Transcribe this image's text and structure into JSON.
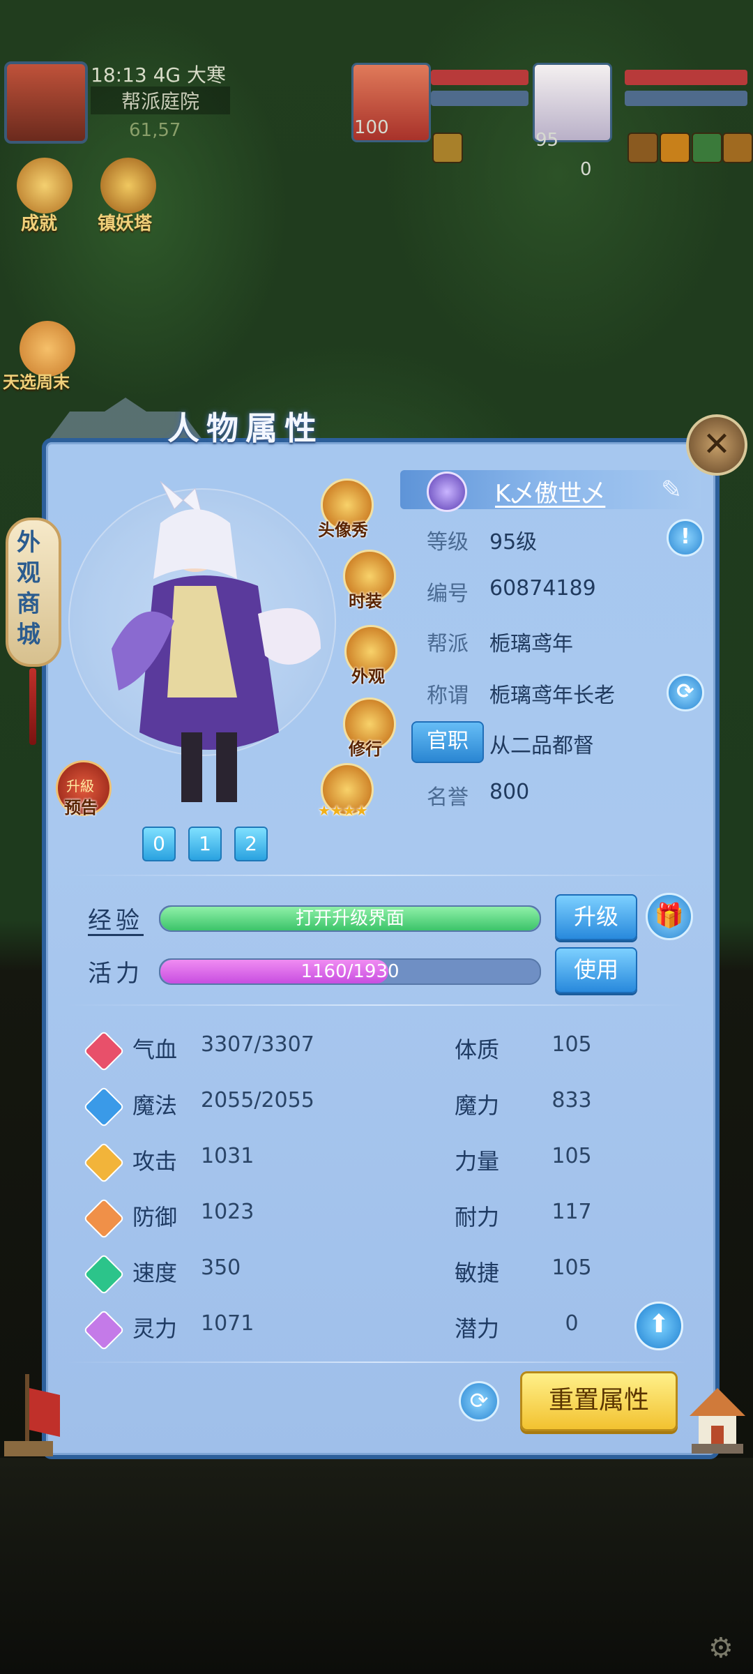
{
  "hud": {
    "time_status": "18:13 4G 大寒",
    "location": "帮派庭院",
    "coordinates": "61,57",
    "achievement_label": "成就",
    "tower_label": "镇妖塔",
    "weekend_label": "天选周末",
    "portrait1_level": "100",
    "portrait2_level": "95",
    "counter": "0"
  },
  "panel": {
    "title": "人物属性",
    "close_icon": "close-icon",
    "shop_tab": "外观商城",
    "side_buttons": [
      {
        "label": "头像秀",
        "icon": "avatar-show-icon"
      },
      {
        "label": "时装",
        "icon": "fashion-icon"
      },
      {
        "label": "外观",
        "icon": "appearance-icon"
      },
      {
        "label": "修行",
        "icon": "cultivation-icon"
      },
      {
        "label": "",
        "icon": "star-rank-icon"
      }
    ],
    "notice_label": "预告",
    "notice_inner": "升級",
    "pages": [
      "0",
      "1",
      "2"
    ],
    "stars": "★★★★"
  },
  "profile": {
    "name": "K乄傲世乄",
    "rows": [
      {
        "label": "等级",
        "value": "95级"
      },
      {
        "label": "编号",
        "value": "60874189"
      },
      {
        "label": "帮派",
        "value": "栀璃鸢年"
      },
      {
        "label": "称谓",
        "value": "栀璃鸢年长老"
      },
      {
        "label": "官职",
        "value": "从二品都督"
      },
      {
        "label": "名誉",
        "value": "800"
      }
    ]
  },
  "progress": {
    "exp_label": "经验",
    "exp_text": "打开升级界面",
    "exp_fraction": 1.0,
    "upgrade_button": "升级",
    "vitality_label": "活力",
    "vitality_text": "1160/1930",
    "vitality_fraction": 0.601,
    "use_button": "使用"
  },
  "stats": [
    {
      "label": "气血",
      "value": "3307/3307",
      "color": "#e8506a",
      "attr_label": "体质",
      "attr_value": "105"
    },
    {
      "label": "魔法",
      "value": "2055/2055",
      "color": "#3a9ae8",
      "attr_label": "魔力",
      "attr_value": "833"
    },
    {
      "label": "攻击",
      "value": "1031",
      "color": "#f2b43a",
      "attr_label": "力量",
      "attr_value": "105"
    },
    {
      "label": "防御",
      "value": "1023",
      "color": "#f09048",
      "attr_label": "耐力",
      "attr_value": "117"
    },
    {
      "label": "速度",
      "value": "350",
      "color": "#2cc48a",
      "attr_label": "敏捷",
      "attr_value": "105"
    },
    {
      "label": "灵力",
      "value": "1071",
      "color": "#c47ae8",
      "attr_label": "潜力",
      "attr_value": "0"
    }
  ],
  "reset_button": "重置属性"
}
